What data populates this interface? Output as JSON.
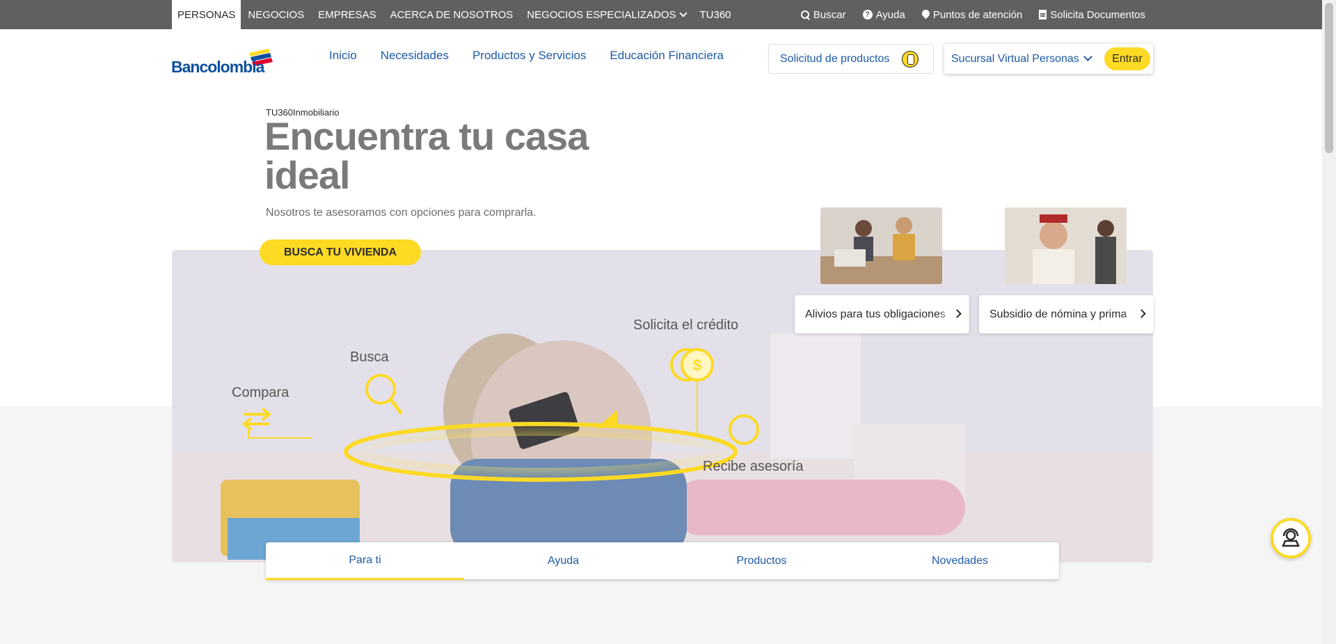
{
  "topbar": {
    "segments": [
      "PERSONAS",
      "NEGOCIOS",
      "EMPRESAS",
      "ACERCA DE NOSOTROS",
      "NEGOCIOS ESPECIALIZADOS",
      "TU360"
    ],
    "utilities": [
      "Buscar",
      "Ayuda",
      "Puntos de atención",
      "Solicita Documentos"
    ]
  },
  "logo": {
    "text": "Bancolombia"
  },
  "mainnav": [
    "Inicio",
    "Necesidades",
    "Productos y Servicios",
    "Educación Financiera"
  ],
  "solicitud_label": "Solicitud de productos",
  "sucursal": {
    "label": "Sucursal Virtual Personas",
    "button": "Entrar"
  },
  "hero": {
    "breadcrumb": "TU360Inmobiliario",
    "title": "Encuentra tu casa ideal",
    "subtitle": "Nosotros te asesoramos con opciones para comprarla.",
    "cta": "BUSCA TU VIVIENDA"
  },
  "banner_steps": [
    "Compara",
    "Busca",
    "Solicita el crédito",
    "Recibe asesoría"
  ],
  "cards": [
    {
      "label": "Alivios para tus obligaciones"
    },
    {
      "label": "Subsidio de nómina y prima"
    }
  ],
  "tabs": [
    "Para ti",
    "Ayuda",
    "Productos",
    "Novedades"
  ],
  "colors": {
    "brand_yellow": "#fdda24",
    "brand_blue": "#1d5aa6",
    "topbar_gray": "#5f6061"
  }
}
